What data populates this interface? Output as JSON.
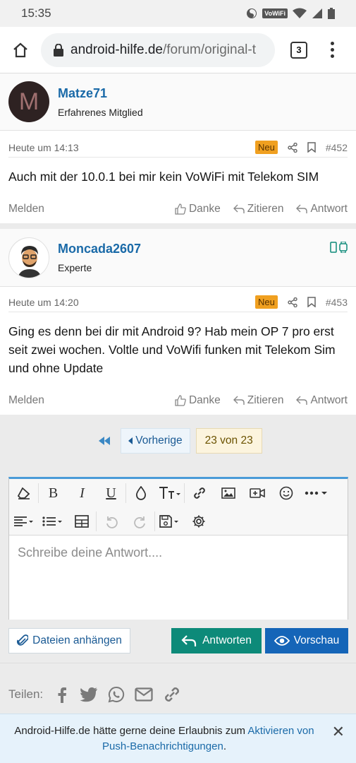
{
  "status_bar": {
    "time": "15:35",
    "badge": "VoWiFi"
  },
  "browser": {
    "url_domain": "android-hilfe.de",
    "url_path": "/forum/original-t",
    "tab_count": "3"
  },
  "posts": [
    {
      "username": "Matze71",
      "avatar_letter": "M",
      "user_title": "Erfahrenes Mitglied",
      "date": "Heute um 14:13",
      "badge": "Neu",
      "number": "#452",
      "text": "Auch mit der 10.0.1 bei mir kein VoWiFi mit Telekom SIM",
      "report": "Melden",
      "like": "Danke",
      "quote": "Zitieren",
      "reply": "Antwort"
    },
    {
      "username": "Moncada2607",
      "user_title": "Experte",
      "date": "Heute um 14:20",
      "badge": "Neu",
      "number": "#453",
      "text": "Ging es denn bei dir mit Android 9? Hab mein OP 7 pro erst seit zwei wochen. Voltle und VoWifi funken mit Telekom Sim und ohne Update",
      "report": "Melden",
      "like": "Danke",
      "quote": "Zitieren",
      "reply": "Antwort"
    }
  ],
  "pagination": {
    "prev": "Vorherige",
    "current": "23 von 23"
  },
  "editor": {
    "placeholder": "Schreibe deine Antwort...."
  },
  "buttons": {
    "attach": "Dateien anhängen",
    "reply": "Antworten",
    "preview": "Vorschau"
  },
  "share": {
    "label": "Teilen:"
  },
  "notice": {
    "text_before": "Android-Hilfe.de hätte gerne deine Erlaubnis zum ",
    "link": "Aktivieren von Push-Benachrichtigungen",
    "text_after": "."
  },
  "colors": {
    "username": "#1a6aa8",
    "badge_new": "#f0a020",
    "reply_button": "#0d8a79",
    "preview_button": "#1565b8",
    "editor_accent": "#4a9bd8"
  }
}
